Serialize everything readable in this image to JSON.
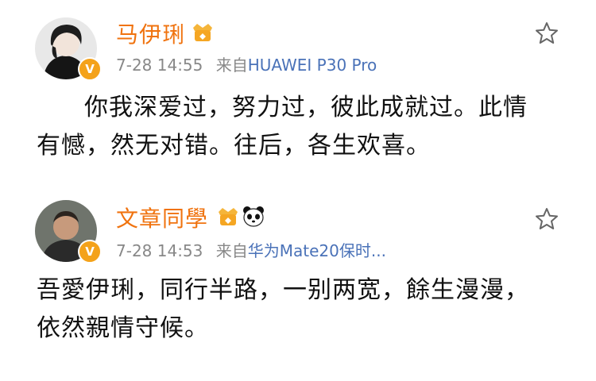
{
  "posts": [
    {
      "author": "马伊琍",
      "time": "7-28 14:55",
      "via": "来自",
      "device": "HUAWEI P30 Pro",
      "text_line1": "你我深爱过，努力过，彼此成就过。此情",
      "text_line2": "有憾，然无对错。往后，各生欢喜。",
      "badge": "V",
      "icons": [
        "avatar",
        "verified-badge-icon",
        "vip-crown-icon",
        "star-icon"
      ]
    },
    {
      "author": "文章同學",
      "time": "7-28 14:53",
      "via": "来自",
      "device": "华为Mate20保时...",
      "text_line1": "吾愛伊琍，同行半路，一别两宽，餘生漫漫，",
      "text_line2": "依然親情守候。",
      "badge": "V",
      "icons": [
        "avatar",
        "verified-badge-icon",
        "vip-crown-icon",
        "panda-icon",
        "star-icon"
      ]
    }
  ],
  "colors": {
    "name": "#f0730f",
    "meta": "#888888",
    "source": "#4a72b8",
    "badge": "#f4a21a"
  }
}
